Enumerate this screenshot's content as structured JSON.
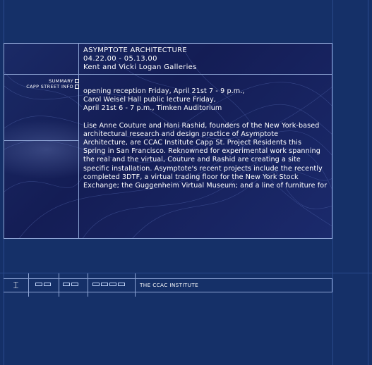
{
  "exhibition": {
    "title": "ASYMPTOTE ARCHITECTURE",
    "dates": "04.22.00 - 05.13.00",
    "venue": "Kent and Vicki Logan Galleries"
  },
  "side_nav": {
    "summary": "SUMMARY",
    "capp_street_info": "CAPP STREET INFO"
  },
  "body": {
    "reception": [
      "opening reception Friday, April 21st  7 - 9 p.m.,",
      "Carol Weisel Hall public lecture Friday,",
      "April 21st 6 - 7 p.m., Timken Auditorium"
    ],
    "description": [
      "Lise Anne Couture and Hani Rashid, founders of the New York-based",
      "architectural research and design practice of Asymptote",
      "Architecture, are CCAC Institute Capp St. Project Residents this",
      "Spring in San Francisco. Reknowned for experimental work spanning",
      "the real and the virtual, Couture and Rashid are creating a site",
      "specific installation. Asymptote's recent projects include the recently",
      "completed 3DTF, a virtual trading floor for the New York Stock",
      "Exchange; the Guggenheim Virtual Museum; and a line of furniture for"
    ]
  },
  "bottom_nav": {
    "logo_glyph": "⌶",
    "label": "THE CCAC INSTITUTE"
  },
  "colors": {
    "background": "#153068",
    "panel_border": "#8fa6d6",
    "text": "#ffffff"
  }
}
